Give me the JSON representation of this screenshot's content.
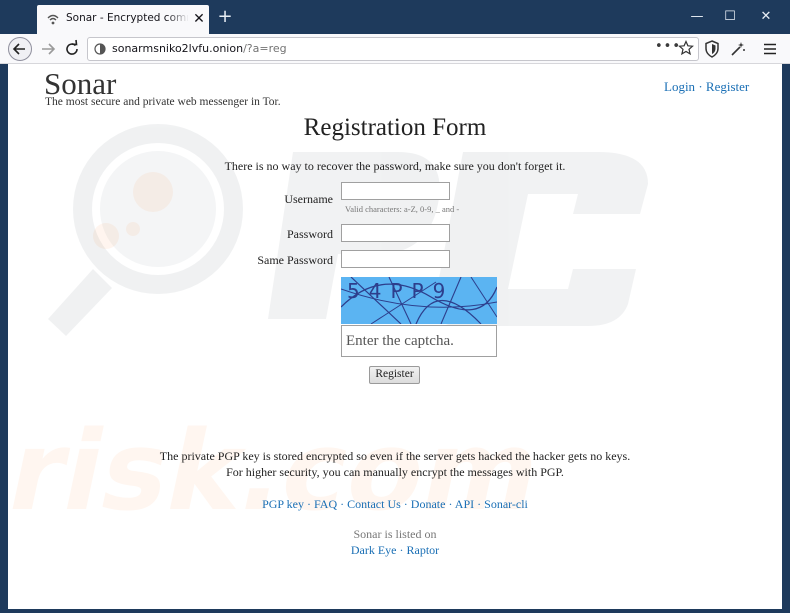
{
  "browser": {
    "tab_title": "Sonar - Encrypted communication",
    "url_host": "sonarmsniko2lvfu.onion",
    "url_path": "/?a=reg",
    "accent": "#1e3a5c"
  },
  "header": {
    "logo": "Sonar",
    "tagline": "The most secure and private web messenger in Tor.",
    "login": "Login",
    "register": "Register",
    "separator": "·"
  },
  "form": {
    "title": "Registration Form",
    "warning": "There is no way to recover the password, make sure you don't forget it.",
    "username_label": "Username",
    "username_hint": "Valid characters: a-Z, 0-9, _ and -",
    "password_label": "Password",
    "same_password_label": "Same Password",
    "captcha_text": "54PP9",
    "captcha_placeholder": "Enter the captcha.",
    "submit": "Register"
  },
  "footer": {
    "info_line1": "The private PGP key is stored encrypted so even if the server gets hacked the hacker gets no keys.",
    "info_line2": "For higher security, you can manually encrypt the messages with PGP.",
    "links": [
      "PGP key",
      "FAQ",
      "Contact Us",
      "Donate",
      "API",
      "Sonar-cli"
    ],
    "listed_on": "Sonar is listed on",
    "listed_links": [
      "Dark Eye",
      "Raptor"
    ]
  },
  "colors": {
    "link": "#1a6fb5",
    "captcha_bg": "#5bb4f2"
  }
}
